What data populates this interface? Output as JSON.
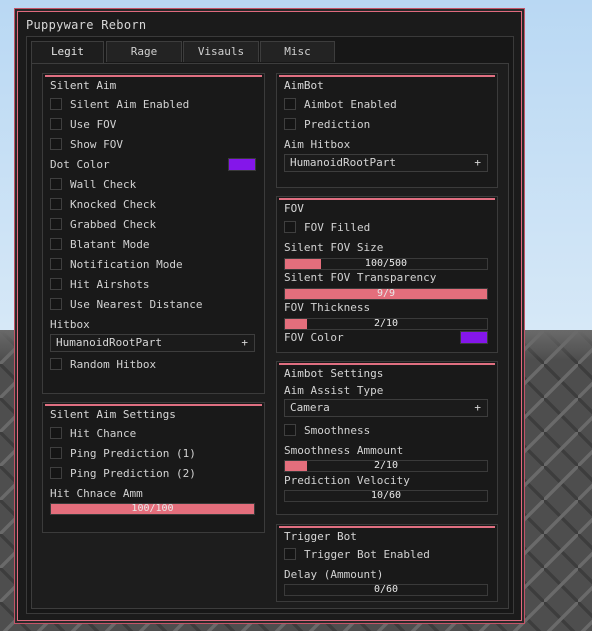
{
  "window": {
    "title": "Puppyware Reborn",
    "accent": "#e06a7e"
  },
  "tabs": [
    "Legit",
    "Rage",
    "Visauls",
    "Misc"
  ],
  "active_tab": "Legit",
  "silent_aim": {
    "title": "Silent Aim",
    "enabled": "Silent Aim Enabled",
    "use_fov": "Use FOV",
    "show_fov": "Show FOV",
    "dot_color_label": "Dot Color",
    "dot_color": "#8416ea",
    "wall_check": "Wall Check",
    "knocked_check": "Knocked Check",
    "grabbed_check": "Grabbed Check",
    "blatant_mode": "Blatant Mode",
    "notification_mode": "Notification Mode",
    "hit_airshots": "Hit Airshots",
    "use_nearest": "Use Nearest Distance",
    "hitbox_label": "Hitbox",
    "hitbox_value": "HumanoidRootPart",
    "random_hitbox": "Random Hitbox"
  },
  "silent_aim_settings": {
    "title": "Silent Aim Settings",
    "hit_chance": "Hit Chance",
    "ping_pred_1": "Ping Prediction (1)",
    "ping_pred_2": "Ping Prediction (2)",
    "hit_chance_amm_label": "Hit Chnace Amm",
    "hit_chance_amm_value": "100/100",
    "hit_chance_amm_fraction": 1.0
  },
  "aimbot": {
    "title": "AimBot",
    "enabled": "Aimbot Enabled",
    "prediction": "Prediction",
    "hitbox_label": "Aim Hitbox",
    "hitbox_value": "HumanoidRootPart"
  },
  "fov": {
    "title": "FOV",
    "filled": "FOV Filled",
    "size_label": "Silent FOV Size",
    "size_value": "100/500",
    "size_fraction": 0.18,
    "transparency_label": "Silent FOV Transparency",
    "transparency_value": "9/9",
    "transparency_fraction": 1.0,
    "thickness_label": "FOV Thickness",
    "thickness_value": "2/10",
    "thickness_fraction": 0.11,
    "color_label": "FOV Color",
    "color": "#8416ea"
  },
  "aimbot_settings": {
    "title": "Aimbot Settings",
    "assist_type_label": "Aim Assist Type",
    "assist_type_value": "Camera",
    "smoothness": "Smoothness",
    "smoothness_amount_label": "Smoothness Ammount",
    "smoothness_amount_value": "2/10",
    "smoothness_amount_fraction": 0.11,
    "pred_velocity_label": "Prediction Velocity",
    "pred_velocity_value": "10/60",
    "pred_velocity_fraction": 0.0
  },
  "trigger_bot": {
    "title": "Trigger Bot",
    "enabled": "Trigger Bot Enabled",
    "delay_label": "Delay (Ammount)",
    "delay_value": "0/60",
    "delay_fraction": 0.0
  },
  "icons": {
    "dropdown": "plus-icon"
  }
}
